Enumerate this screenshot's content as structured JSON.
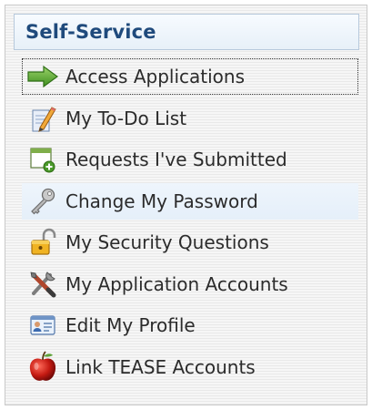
{
  "panel": {
    "title": "Self-Service"
  },
  "menu": {
    "items": [
      {
        "label": "Access Applications",
        "icon": "green-arrow-icon"
      },
      {
        "label": "My To-Do List",
        "icon": "pencil-document-icon"
      },
      {
        "label": "Requests I've Submitted",
        "icon": "window-add-icon"
      },
      {
        "label": "Change My Password",
        "icon": "key-icon"
      },
      {
        "label": "My Security Questions",
        "icon": "padlock-icon"
      },
      {
        "label": "My Application Accounts",
        "icon": "tools-icon"
      },
      {
        "label": "Edit My Profile",
        "icon": "id-card-icon"
      },
      {
        "label": "Link TEASE Accounts",
        "icon": "apple-icon"
      }
    ]
  },
  "colors": {
    "title": "#1f4a7c",
    "text": "#2b2b2b",
    "header_border": "#b7c9dc",
    "hover_background": "#e5eff9"
  }
}
